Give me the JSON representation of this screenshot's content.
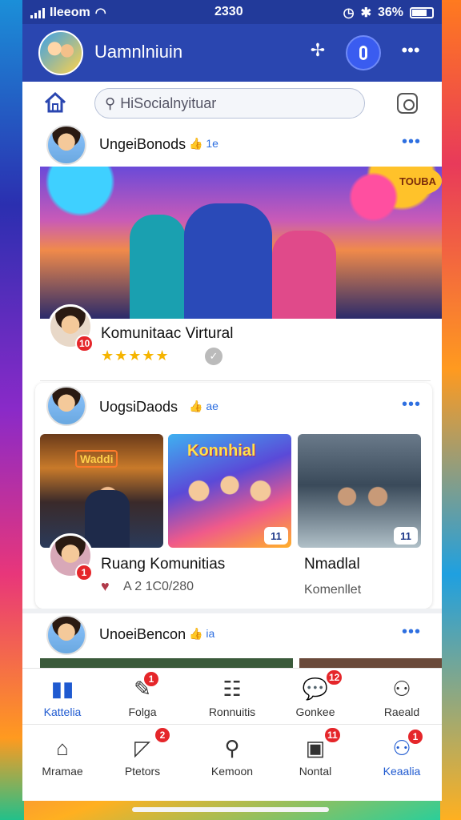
{
  "status_bar": {
    "carrier": "IIeeom",
    "time": "2330",
    "battery": "36%"
  },
  "app_bar": {
    "title": "Uamnlniuin"
  },
  "search": {
    "placeholder": "HiSocialnyituar"
  },
  "post1": {
    "author": "UngeiBonods",
    "meta": "1e"
  },
  "hero": {
    "sign_text": "TOUBA"
  },
  "community": {
    "title": "Komunitaac Virtural",
    "rating": 5,
    "stars": "★★★★★",
    "badge": "10"
  },
  "post2": {
    "author": "UogsiDaods",
    "meta": "ae"
  },
  "tiles": [
    {
      "neon": "Waddi"
    },
    {
      "banner": "Konnhial",
      "corner": "11"
    },
    {
      "corner": "11"
    }
  ],
  "tile_captions": {
    "left_title": "Ruang Komunitias",
    "left_badge": "1",
    "left_sub": "A 2 1C0/280",
    "right_title": "Nmadlal",
    "right_sub": "Komenllet"
  },
  "post3": {
    "author": "UnoeiBencon",
    "meta": "ia"
  },
  "tabs": [
    {
      "label": "Kattelia",
      "icon": "chart-icon",
      "badge": ""
    },
    {
      "label": "Folga",
      "icon": "edit-icon",
      "badge": "1"
    },
    {
      "label": "Ronnuitis",
      "icon": "list-icon",
      "badge": ""
    },
    {
      "label": "Gonkee",
      "icon": "chat-icon",
      "badge": "12"
    },
    {
      "label": "Raeald",
      "icon": "user-icon",
      "badge": ""
    }
  ],
  "nav": [
    {
      "label": "Mramae",
      "icon": "home-icon",
      "badge": ""
    },
    {
      "label": "Ptetors",
      "icon": "tag-icon",
      "badge": "2"
    },
    {
      "label": "Kemoon",
      "icon": "search-icon",
      "badge": ""
    },
    {
      "label": "Nontal",
      "icon": "bag-icon",
      "badge": "11"
    },
    {
      "label": "Keaalia",
      "icon": "profile-icon",
      "badge": "1"
    }
  ],
  "colors": {
    "primary": "#2a46b0",
    "accent": "#1f5ad0",
    "badge": "#e5262a",
    "star": "#f5b400"
  }
}
